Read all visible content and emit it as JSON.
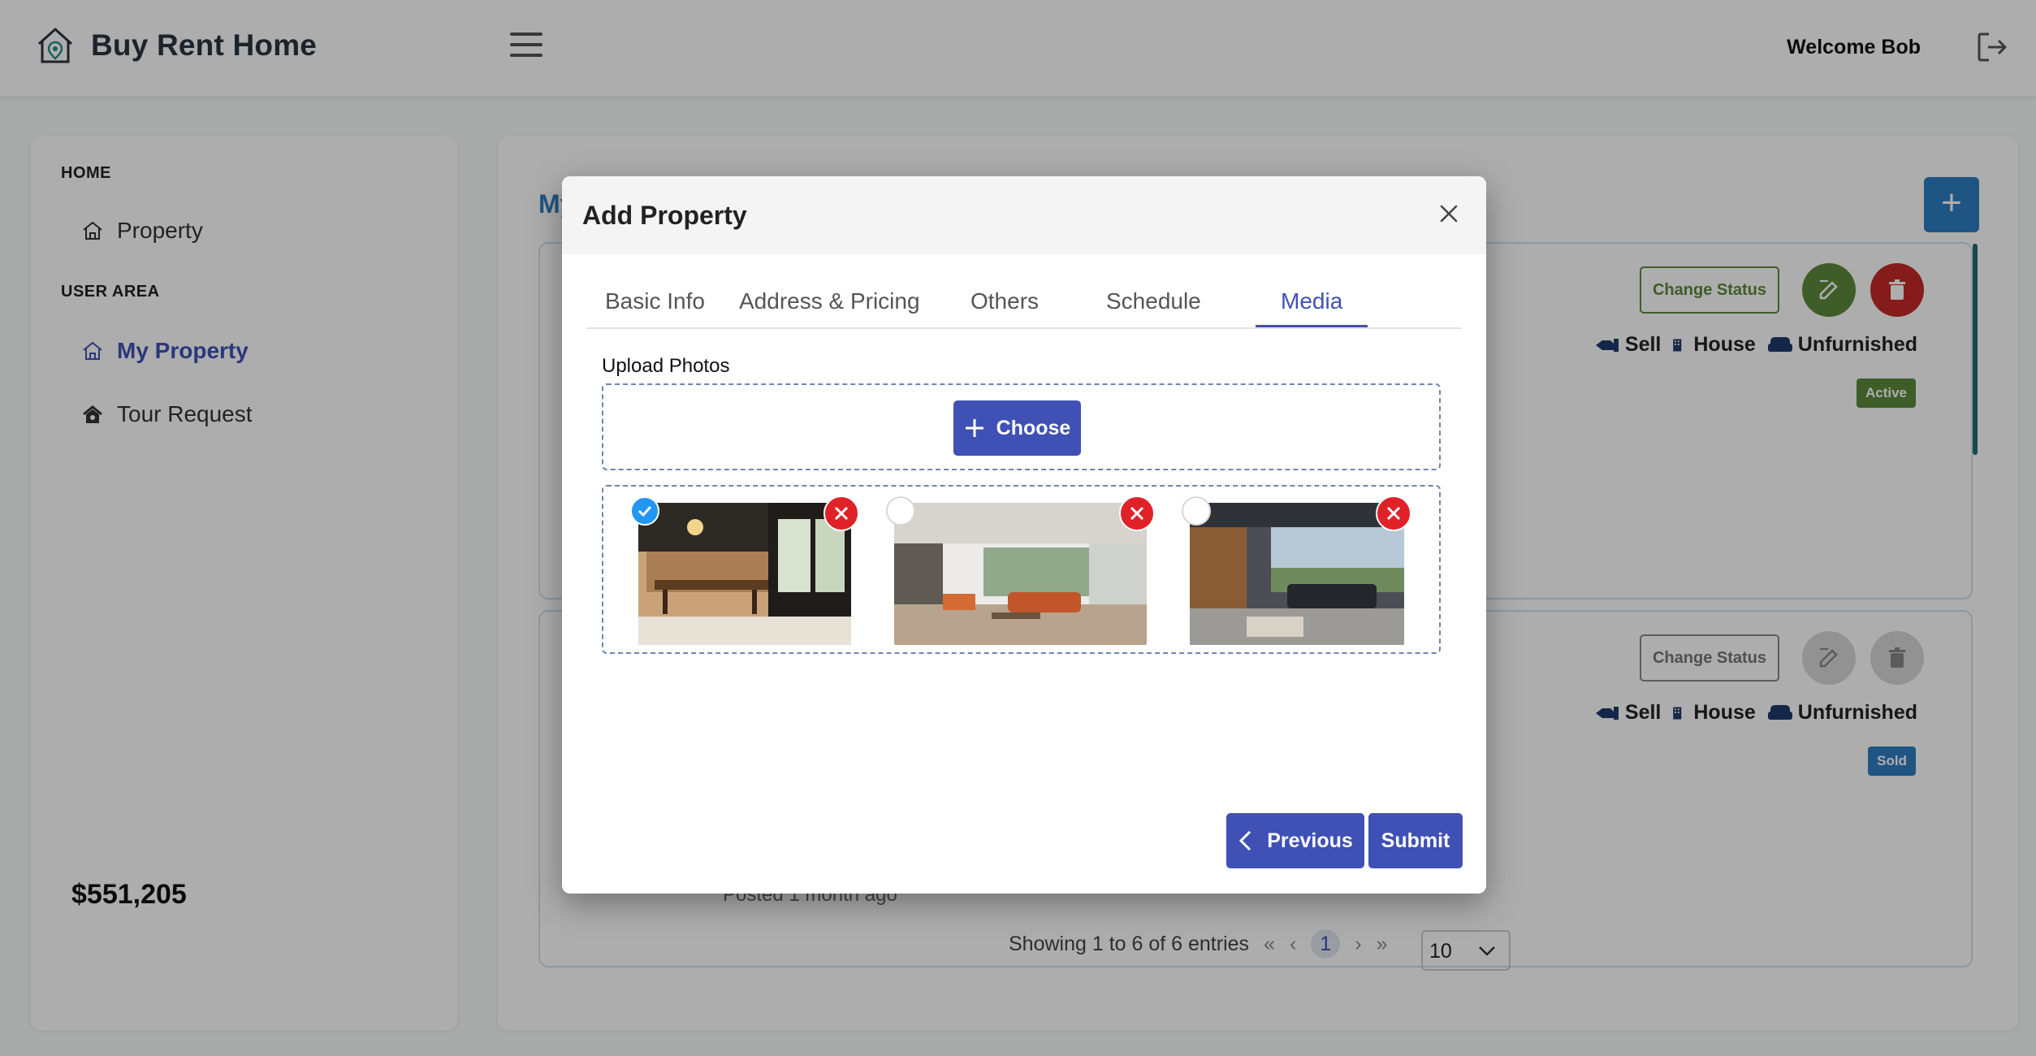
{
  "app": {
    "brand": "Buy Rent Home",
    "welcome": "Welcome Bob"
  },
  "sidebar": {
    "home_heading": "HOME",
    "user_area_heading": "USER AREA",
    "items": [
      {
        "label": "Property",
        "icon": "home-icon"
      },
      {
        "label": "My Property",
        "icon": "home-icon",
        "active": true
      },
      {
        "label": "Tour Request",
        "icon": "tour-house-icon"
      }
    ]
  },
  "main": {
    "title": "My",
    "add_label": "+",
    "cards": [
      {
        "change_status": "Change Status",
        "tags": [
          "Sell",
          "House",
          "Unfurnished"
        ],
        "status": "Active",
        "status_color": "#5c8a3c"
      },
      {
        "change_status": "Change Status",
        "tags": [
          "Sell",
          "House",
          "Unfurnished"
        ],
        "status": "Sold",
        "status_color": "#2f7ec0"
      }
    ],
    "price": "$551,205",
    "posted": "Posted 1 month ago"
  },
  "pagination": {
    "summary": "Showing 1 to 6 of 6 entries",
    "first": "«",
    "prev": "‹",
    "current": "1",
    "next": "›",
    "last": "»",
    "rows_per_page": "10"
  },
  "modal": {
    "title": "Add Property",
    "tabs": [
      "Basic Info",
      "Address & Pricing",
      "Others",
      "Schedule",
      "Media"
    ],
    "active_tab": "Media",
    "upload_label": "Upload Photos",
    "choose_label": "Choose",
    "photos": [
      {
        "selected": true,
        "alt": "kitchen-dining-photo"
      },
      {
        "selected": false,
        "alt": "living-room-photo"
      },
      {
        "selected": false,
        "alt": "lounge-photo"
      }
    ],
    "previous_label": "Previous",
    "submit_label": "Submit"
  },
  "colors": {
    "primary": "#3f51b5",
    "accent_blue": "#2f7ec0",
    "green": "#5c8a3c",
    "red": "#c62828"
  }
}
